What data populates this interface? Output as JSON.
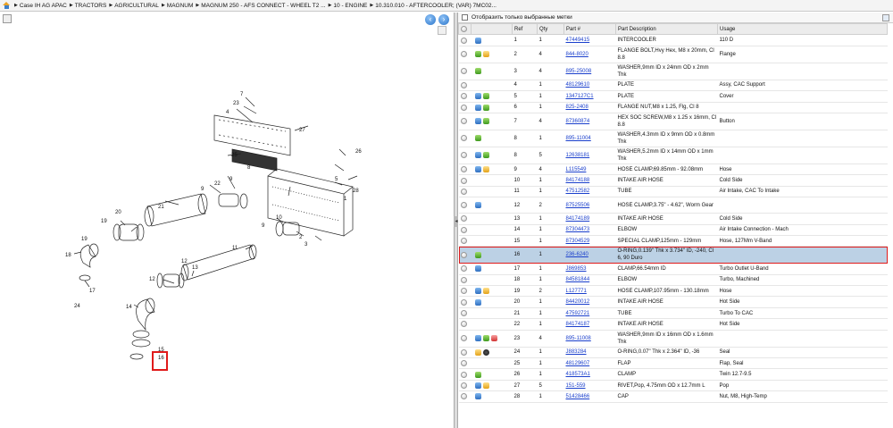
{
  "breadcrumb": {
    "items": [
      "Case IH AG APAC",
      "TRACTORS",
      "AGRICULTURAL",
      "MAGNUM",
      "MAGNUM 250 - AFS CONNECT - WHEEL T2 ...",
      "10 - ENGINE",
      "10.310.010 - AFTERCOOLER; (VAR) 7MC02..."
    ]
  },
  "filter": {
    "label": "Отобразить только выбранные метки"
  },
  "table": {
    "headers": [
      "Ref",
      "Qty",
      "Part #",
      "Part Description",
      "Usage"
    ],
    "rows": [
      {
        "ref": "1",
        "qty": "1",
        "part": "47449415",
        "desc": "INTERCOOLER",
        "usage": "110 D",
        "icons": [
          "blue"
        ]
      },
      {
        "ref": "2",
        "qty": "4",
        "part": "844-8020",
        "desc": "FLANGE BOLT,Hvy Hex, M8 x 20mm, Cl 8.8",
        "usage": "Flange",
        "icons": [
          "green",
          "yellow"
        ]
      },
      {
        "ref": "3",
        "qty": "4",
        "part": "895-25008",
        "desc": "WASHER,9mm ID x 24mm OD x 2mm Thk",
        "usage": "",
        "icons": [
          "green"
        ]
      },
      {
        "ref": "4",
        "qty": "1",
        "part": "48129610",
        "desc": "PLATE",
        "usage": "Assy, CAC Support",
        "icons": []
      },
      {
        "ref": "5",
        "qty": "1",
        "part": "1347127C1",
        "desc": "PLATE",
        "usage": "Cover",
        "icons": [
          "blue",
          "green"
        ]
      },
      {
        "ref": "6",
        "qty": "1",
        "part": "825-2408",
        "desc": "FLANGE NUT,M8 x 1.25, Flg, Cl 8",
        "usage": "",
        "icons": [
          "blue",
          "green"
        ]
      },
      {
        "ref": "7",
        "qty": "4",
        "part": "87360874",
        "desc": "HEX SOC SCREW,M8 x 1.25 x 16mm, Cl 8.8",
        "usage": "Button",
        "icons": [
          "blue",
          "green"
        ]
      },
      {
        "ref": "8",
        "qty": "1",
        "part": "895-11004",
        "desc": "WASHER,4.3mm ID x 9mm OD x 0.8mm Thk",
        "usage": "",
        "icons": [
          "green"
        ]
      },
      {
        "ref": "8",
        "qty": "5",
        "part": "12638181",
        "desc": "WASHER,5.2mm ID x 14mm OD x 1mm Thk",
        "usage": "",
        "icons": [
          "blue",
          "green"
        ]
      },
      {
        "ref": "9",
        "qty": "4",
        "part": "L115549",
        "desc": "HOSE CLAMP,69.85mm - 92.08mm",
        "usage": "Hose",
        "icons": [
          "blue",
          "yellow"
        ]
      },
      {
        "ref": "10",
        "qty": "1",
        "part": "84174188",
        "desc": "INTAKE AIR HOSE",
        "usage": "Cold Side",
        "icons": []
      },
      {
        "ref": "11",
        "qty": "1",
        "part": "47512582",
        "desc": "TUBE",
        "usage": "Air Intake, CAC To Intake",
        "icons": []
      },
      {
        "ref": "12",
        "qty": "2",
        "part": "87525506",
        "desc": "HOSE CLAMP,3.75\" - 4.62\", Worm Gear",
        "usage": "",
        "icons": [
          "blue"
        ]
      },
      {
        "ref": "13",
        "qty": "1",
        "part": "84174189",
        "desc": "INTAKE AIR HOSE",
        "usage": "Cold Side",
        "icons": []
      },
      {
        "ref": "14",
        "qty": "1",
        "part": "87304473",
        "desc": "ELBOW",
        "usage": "Air Intake Connection - Mach",
        "icons": []
      },
      {
        "ref": "15",
        "qty": "1",
        "part": "87304529",
        "desc": "SPECIAL CLAMP,125mm - 129mm",
        "usage": "Hose, 127Mm V-Band",
        "icons": []
      },
      {
        "ref": "16",
        "qty": "1",
        "part": "236-6240",
        "desc": "O-RING,0.139\" Thk x 3.734\" ID, -240, Cl 6, 90 Duro",
        "usage": "",
        "icons": [
          "green"
        ],
        "selected": true
      },
      {
        "ref": "17",
        "qty": "1",
        "part": "J869853",
        "desc": "CLAMP,66.54mm ID",
        "usage": "Turbo Outlet U-Band",
        "icons": [
          "blue"
        ]
      },
      {
        "ref": "18",
        "qty": "1",
        "part": "84581844",
        "desc": "ELBOW",
        "usage": "Turbo, Machined",
        "icons": []
      },
      {
        "ref": "19",
        "qty": "2",
        "part": "L127771",
        "desc": "HOSE CLAMP,107.95mm - 130.18mm",
        "usage": "Hose",
        "icons": [
          "blue",
          "yellow"
        ]
      },
      {
        "ref": "20",
        "qty": "1",
        "part": "84420012",
        "desc": "INTAKE AIR HOSE",
        "usage": "Hot Side",
        "icons": [
          "blue"
        ]
      },
      {
        "ref": "21",
        "qty": "1",
        "part": "47592721",
        "desc": "TUBE",
        "usage": "Turbo To CAC",
        "icons": []
      },
      {
        "ref": "22",
        "qty": "1",
        "part": "84174187",
        "desc": "INTAKE AIR HOSE",
        "usage": "Hot Side",
        "icons": []
      },
      {
        "ref": "23",
        "qty": "4",
        "part": "895-11008",
        "desc": "WASHER,9mm ID x 16mm OD x 1.6mm Thk",
        "usage": "",
        "icons": [
          "blue",
          "green",
          "red"
        ]
      },
      {
        "ref": "24",
        "qty": "1",
        "part": "J883284",
        "desc": "O-RING,0.07\" Thk x 2.364\" ID, -36",
        "usage": "Seal",
        "icons": [
          "yellow",
          "dark"
        ]
      },
      {
        "ref": "25",
        "qty": "1",
        "part": "48129607",
        "desc": "FLAP",
        "usage": "Flap, Seal",
        "icons": []
      },
      {
        "ref": "26",
        "qty": "1",
        "part": "418573A1",
        "desc": "CLAMP",
        "usage": "Twin 12.7-9.5",
        "icons": [
          "green"
        ]
      },
      {
        "ref": "27",
        "qty": "5",
        "part": "151-559",
        "desc": "RIVET,Pop, 4.75mm OD x 12.7mm L",
        "usage": "Pop",
        "icons": [
          "blue",
          "yellow"
        ]
      },
      {
        "ref": "28",
        "qty": "1",
        "part": "51428466",
        "desc": "CAP",
        "usage": "Nut, M8, High-Temp",
        "icons": [
          "blue"
        ]
      }
    ]
  },
  "diagram": {
    "labels": [
      "7",
      "23",
      "4",
      "27",
      "25",
      "26",
      "5",
      "28",
      "1",
      "8",
      "9",
      "22",
      "9",
      "21",
      "20",
      "19",
      "19",
      "18",
      "10",
      "9",
      "2",
      "3",
      "11",
      "13",
      "12",
      "12",
      "14",
      "17",
      "24",
      "15",
      "16"
    ]
  }
}
